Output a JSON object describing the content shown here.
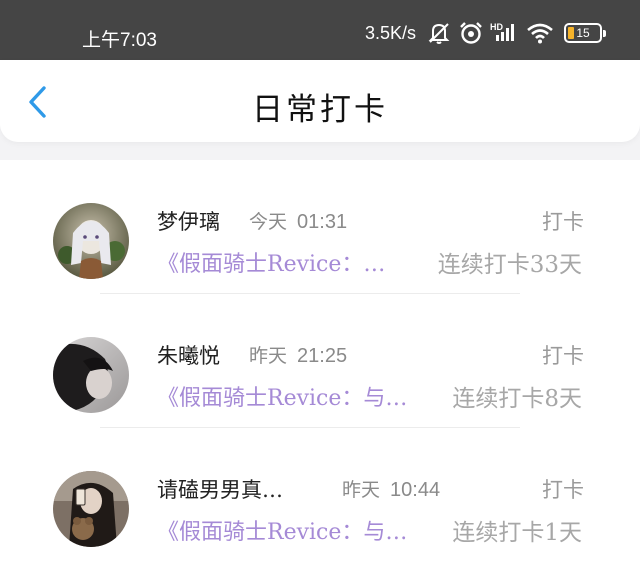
{
  "status_bar": {
    "time": "上午7:03",
    "speed": "3.5K/s",
    "battery_level": "15",
    "icons": [
      "mute-icon",
      "alarm-icon",
      "hd-signal-icon",
      "wifi-icon",
      "battery-icon"
    ],
    "battery_color": "#f5b32a"
  },
  "nav": {
    "title": "日常打卡",
    "back_icon": "chevron-left-icon",
    "accent": "#2f9ae8"
  },
  "checkins": [
    {
      "name": "梦伊璃",
      "day": "今天",
      "time": "01:31",
      "action": "打卡",
      "book": "《假面骑士Revice：…",
      "streak": "连续打卡33天"
    },
    {
      "name": "朱曦悦",
      "day": "昨天",
      "time": "21:25",
      "action": "打卡",
      "book": "《假面骑士Revice：与…",
      "streak": "连续打卡8天"
    },
    {
      "name": "请磕男男真…",
      "day": "昨天",
      "time": "10:44",
      "action": "打卡",
      "book": "《假面骑士Revice：与…",
      "streak": "连续打卡1天"
    }
  ],
  "colors": {
    "book_title": "#a58ad6",
    "muted_text": "#a7a7a7",
    "status_bar_bg": "#454545"
  }
}
